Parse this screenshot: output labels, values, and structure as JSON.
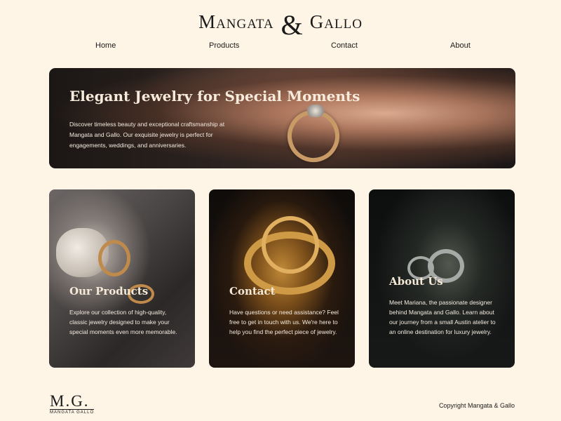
{
  "brand": {
    "first": "Mangata",
    "amp": "&",
    "second": "Gallo"
  },
  "nav": {
    "home": "Home",
    "products": "Products",
    "contact": "Contact",
    "about": "About"
  },
  "hero": {
    "title": "Elegant Jewelry for Special Moments",
    "text": "Discover timeless beauty and exceptional craftsmanship at Mangata and Gallo. Our exquisite jewelry is perfect for engagements, weddings, and anniversaries."
  },
  "cards": {
    "products": {
      "title": "Our Products",
      "text": "Explore our collection of high-quality, classic jewelry designed to make your special moments even more memorable."
    },
    "contact": {
      "title": "Contact",
      "text": "Have questions or need assistance? Feel free to get in touch with us. We're here to help you find the perfect piece of jewelry."
    },
    "about": {
      "title": "About Us",
      "text": "Meet Mariana, the passionate designer behind Mangata and Gallo. Learn about our journey from a small Austin atelier to an online destination for luxury jewelry."
    }
  },
  "footer": {
    "logo_main": "M.G.",
    "logo_sub": "MANGATA GALLO",
    "copyright": "Copyright Mangata & Gallo"
  },
  "colors": {
    "background": "#fff5e6",
    "text": "#1a1a1a",
    "card_text": "#f4ebdf"
  }
}
